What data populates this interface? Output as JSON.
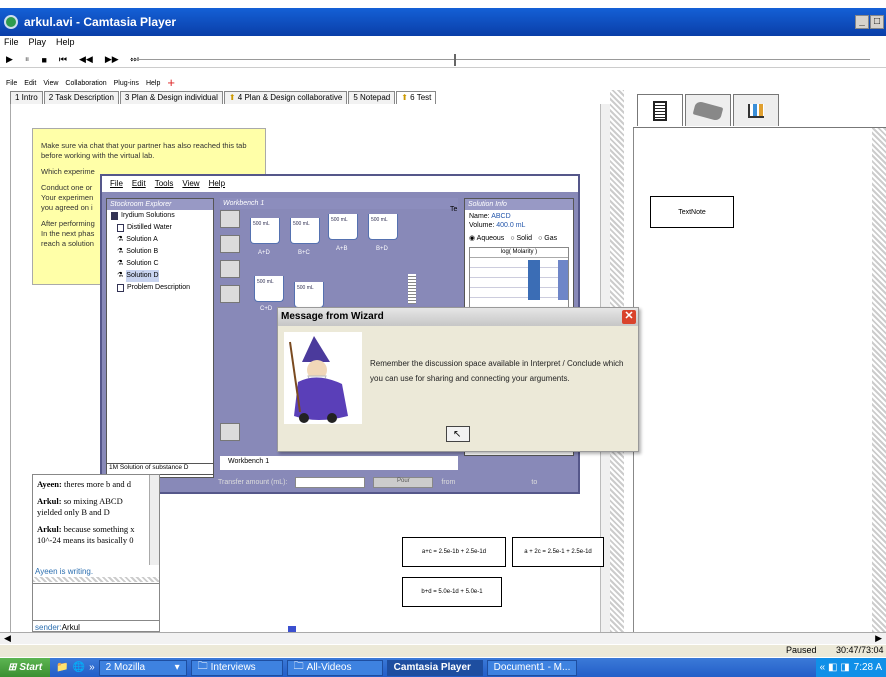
{
  "window": {
    "title": "arkul.avi - Camtasia Player",
    "min": "_",
    "max": "□"
  },
  "player_menu": [
    "File",
    "Play",
    "Help"
  ],
  "player_controls": [
    "▶",
    "⏸",
    "■",
    "⏮",
    "◀◀",
    "▶▶",
    "⏭"
  ],
  "app_menu": [
    "File",
    "Edit",
    "View",
    "Collaboration",
    "Plug-ins",
    "Help"
  ],
  "tabs": [
    {
      "label": "1 Intro"
    },
    {
      "label": "2 Task Description"
    },
    {
      "label": "3 Plan & Design individual"
    },
    {
      "label": "4 Plan & Design collaborative"
    },
    {
      "label": "5 Notepad"
    },
    {
      "label": "6 Test"
    }
  ],
  "sticky": {
    "p1": "Make sure via chat that your partner has also reached this tab before working with the virtual lab.",
    "p2": "Which experime",
    "p3": "Conduct one or",
    "p4": "Your experimen",
    "p5": "you agreed on i",
    "p6": "After performing",
    "p7": "In the next phas",
    "p8": "reach a solution"
  },
  "lab": {
    "menu": [
      "File",
      "Edit",
      "Tools",
      "View",
      "Help"
    ],
    "explorer_title": "Stockroom Explorer",
    "tree": [
      "Irydium Solutions",
      "Distilled Water",
      "Solution A",
      "Solution B",
      "Solution C",
      "Solution D",
      "Problem Description"
    ],
    "status": "1M Solution of substance D",
    "workbench_title": "Workbench 1",
    "workbench_tab": "Workbench 1",
    "beaker_labels": [
      "A+D",
      "B+C",
      "A+B",
      "B+D",
      "C+D"
    ],
    "beaker_text": "500 mL",
    "transfer_label": "Transfer amount (mL):",
    "pour_label": "Pour",
    "from_label": "from",
    "to_label": "to",
    "sol_title": "Solution Info",
    "sol_name_label": "Name:",
    "sol_name": "ABCD",
    "sol_volume_label": "Volume:",
    "sol_volume": "400.0 mL",
    "phases": [
      "Aqueous",
      "Solid",
      "Gas"
    ],
    "chart_title": "log( Molarity )",
    "cut_text": "Te"
  },
  "dialog": {
    "title": "Message from Wizard",
    "message": "Remember the discussion space available in Interpret / Conclude which you can use for sharing and connecting your arguments.",
    "close": "✕"
  },
  "chat": {
    "messages": [
      {
        "from": "Ayeen:",
        "text": " theres more b and d"
      },
      {
        "from": "Arkul:",
        "text": " so mixing ABCD yielded only B and D"
      },
      {
        "from": "Arkul:",
        "text": " because something x 10^-24 means its basically 0"
      }
    ],
    "writing": "Ayeen is writing.",
    "sender_label": "sender:",
    "sender_name": "Arkul"
  },
  "equations": [
    "a+c = 2.5e-1b + 2.5e-1d",
    "a + 2c = 2.5e-1 + 2.5e-1d",
    "b+d = 5.0e-1d + 5.0e-1"
  ],
  "textnote": "TextNote",
  "status": {
    "state": "Paused",
    "time": "30:47/73:04"
  },
  "taskbar": {
    "start": "Start",
    "items": [
      {
        "label": "2 Mozilla"
      },
      {
        "label": "Interviews"
      },
      {
        "label": "All-Videos"
      },
      {
        "label": "Camtasia Player",
        "active": true
      },
      {
        "label": "Document1 - M..."
      }
    ],
    "clock": "7:28 A"
  }
}
